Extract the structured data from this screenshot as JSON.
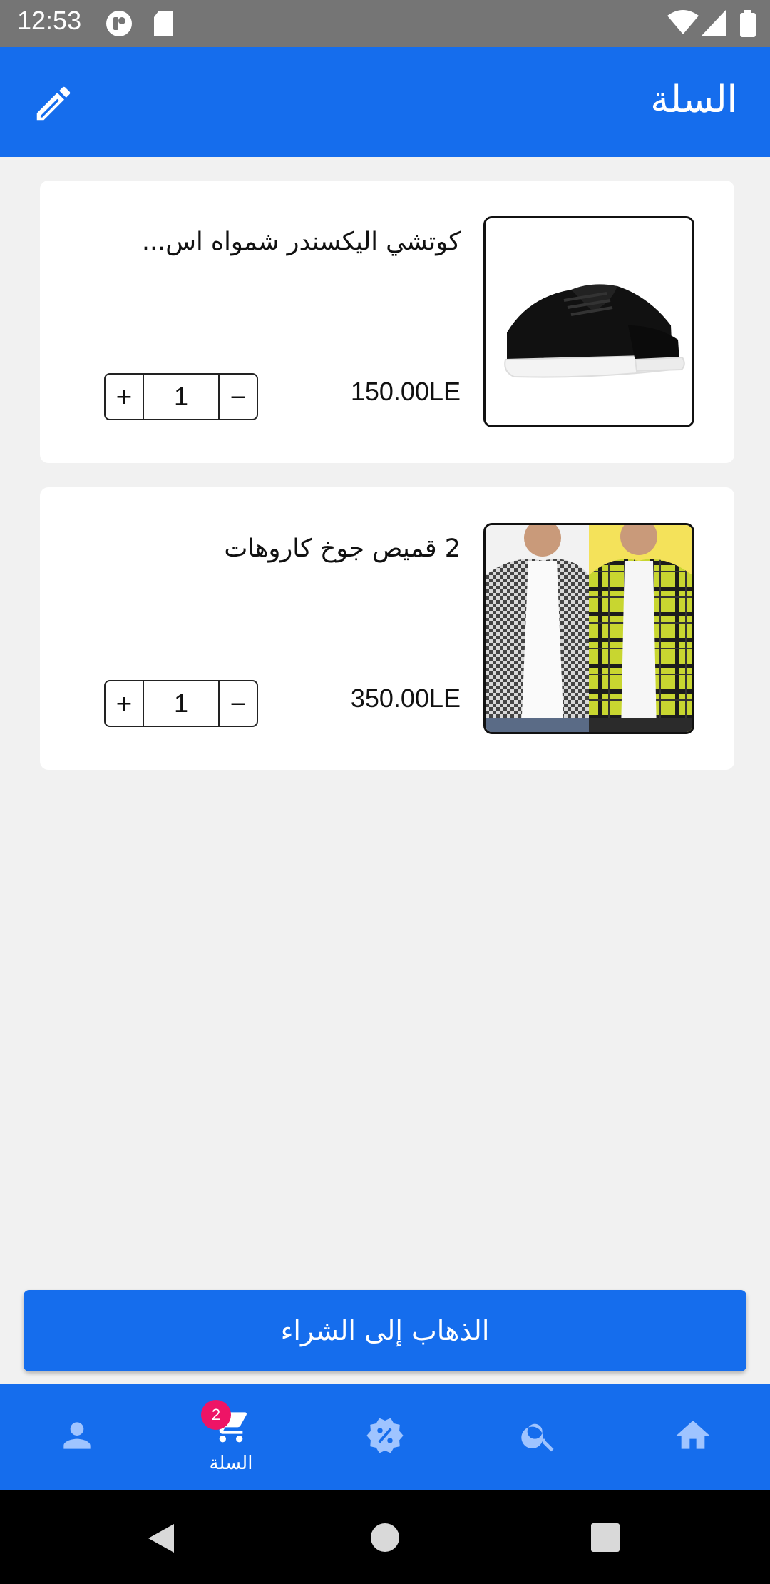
{
  "status_bar": {
    "time": "12:53"
  },
  "app_bar": {
    "title": "السلة"
  },
  "cart_items": [
    {
      "name": "كوتشي اليكسندر شمواه اس...",
      "price": "150.00LE",
      "quantity": "1",
      "plus": "+",
      "minus": "−"
    },
    {
      "name": "2 قميص جوخ كاروهات",
      "price": "350.00LE",
      "quantity": "1",
      "plus": "+",
      "minus": "−"
    }
  ],
  "checkout": {
    "label": "الذهاب إلى الشراء"
  },
  "bottom_nav": {
    "cart_label": "السلة",
    "cart_badge": "2",
    "items": [
      "profile-icon",
      "cart-icon",
      "offers-icon",
      "search-icon",
      "home-icon"
    ]
  },
  "colors": {
    "primary": "#156ded",
    "badge": "#ee1466",
    "background": "#f1f1f1"
  }
}
